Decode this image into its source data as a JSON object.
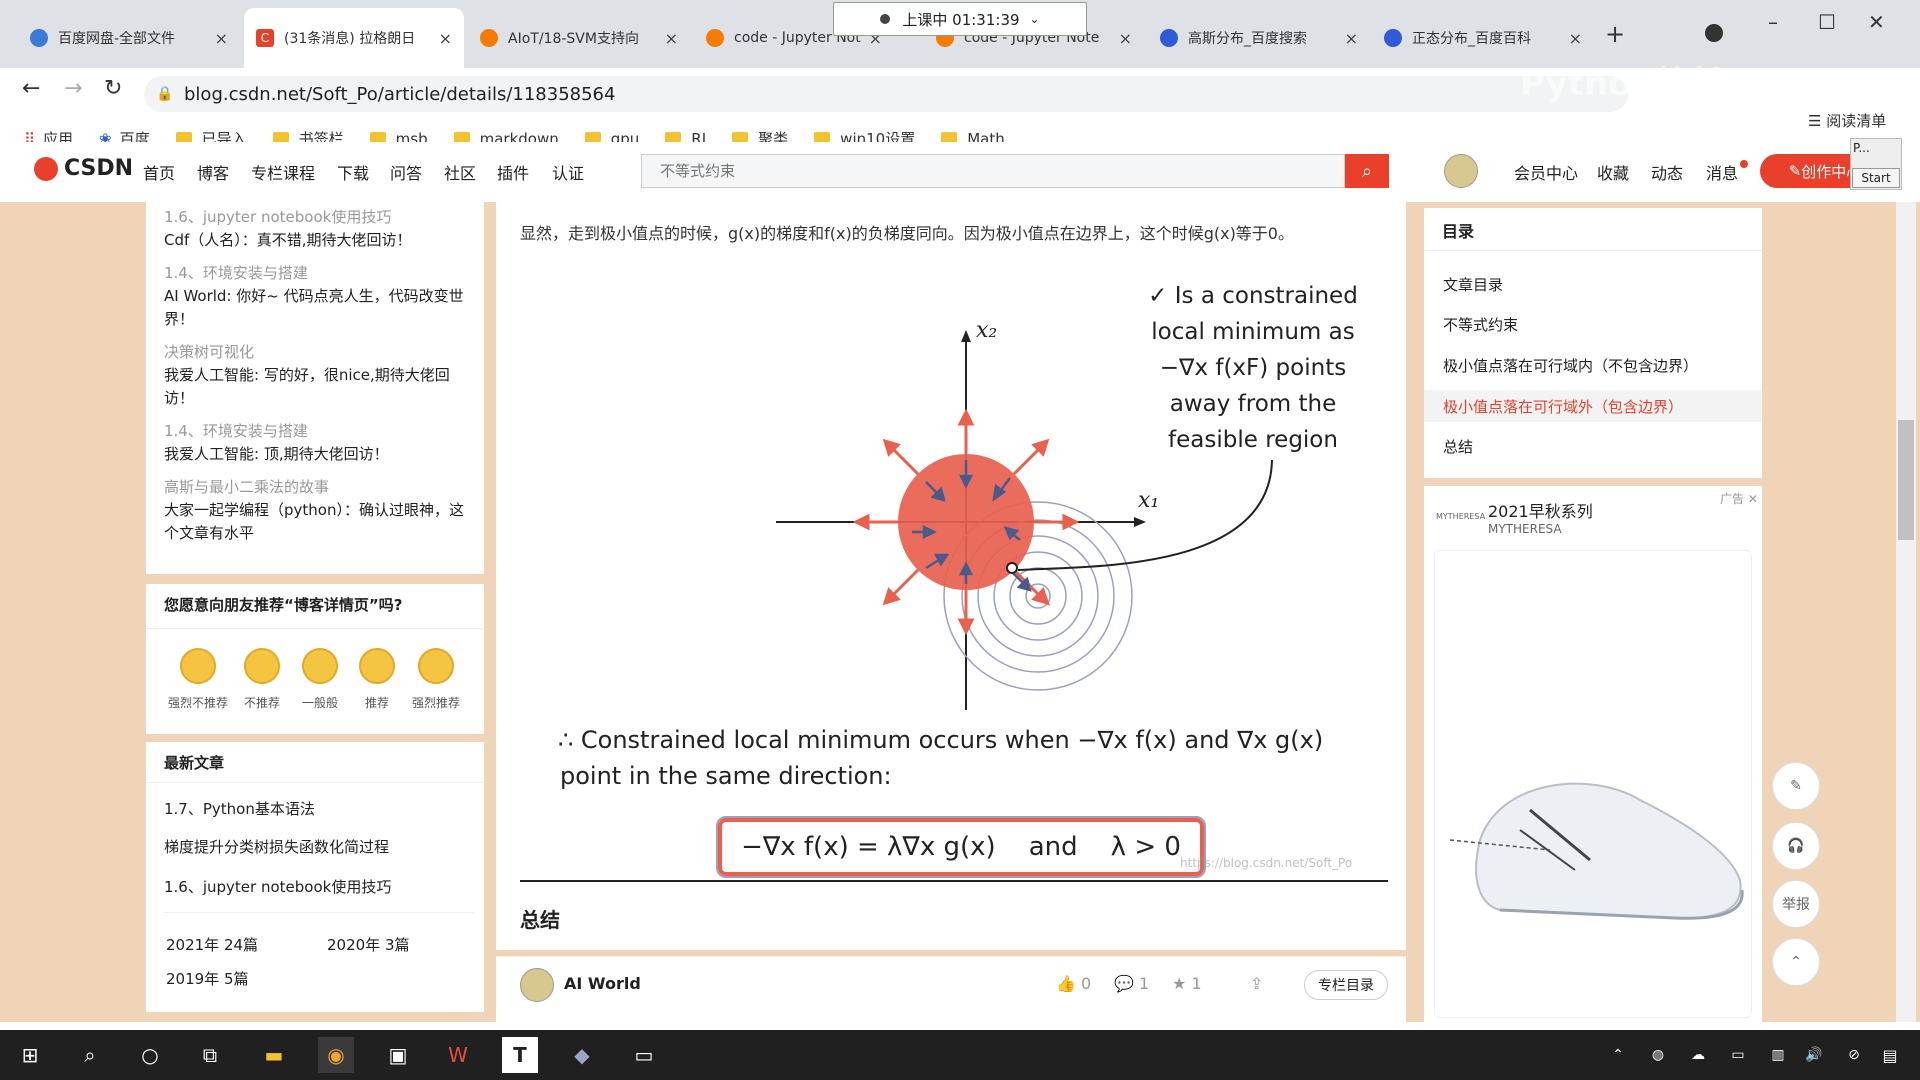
{
  "tabs": [
    {
      "title": "百度网盘-全部文件",
      "icon_color": "#3a7bd5"
    },
    {
      "title": "(31条消息) 拉格朗日",
      "icon_color": "#e8402b",
      "active": true
    },
    {
      "title": "AIoT/18-SVM支持向",
      "icon_color": "#f57c00"
    },
    {
      "title": "code - Jupyter Not",
      "icon_color": "#f57c00"
    },
    {
      "title": "code - Jupyter Note",
      "icon_color": "#f57c00"
    },
    {
      "title": "高斯分布_百度搜索",
      "icon_color": "#2f5bd8"
    },
    {
      "title": "正态分布_百度百科",
      "icon_color": "#2f5bd8"
    }
  ],
  "recording": "上课中 01:31:39",
  "url": "blog.csdn.net/Soft_Po/article/details/118358564",
  "watermark_top": "Python校长",
  "bookmarks": [
    "应用",
    "百度",
    "已导入",
    "书签栏",
    "msb",
    "markdown",
    "gpu",
    "RI",
    "聚类",
    "win10设置",
    "Math"
  ],
  "reading_list": "阅读清单",
  "csdn": {
    "logo": "CSDN",
    "nav": [
      "首页",
      "博客",
      "专栏课程",
      "下载",
      "问答",
      "社区",
      "插件",
      "认证"
    ],
    "search_placeholder": "不等式约束",
    "right": [
      "会员中心",
      "收藏",
      "动态",
      "消息"
    ],
    "create": "创作中心",
    "start_popup": "Start",
    "popup_p": "P..."
  },
  "sidebar_comments": [
    {
      "title": "1.6、jupyter notebook使用技巧",
      "comment": "Cdf（人名）：真不错,期待大佬回访！"
    },
    {
      "title": "1.4、环境安装与搭建",
      "comment": "AI World: 你好~ 代码点亮人生，代码改变世界！"
    },
    {
      "title": "决策树可视化",
      "comment": "我爱人工智能: 写的好，很nice,期待大佬回访！"
    },
    {
      "title": "1.4、环境安装与搭建",
      "comment": "我爱人工智能: 顶,期待大佬回访！"
    },
    {
      "title": "高斯与最小二乘法的故事",
      "comment": "大家一起学编程（python）：确认过眼神，这个文章有水平"
    }
  ],
  "recommend": {
    "question": "您愿意向朋友推荐“博客详情页”吗?",
    "options": [
      "强烈不推荐",
      "不推荐",
      "一般般",
      "推荐",
      "强烈推荐"
    ]
  },
  "latest": {
    "title": "最新文章",
    "items": [
      "1.7、Python基本语法",
      "梯度提升分类树损失函数化简过程",
      "1.6、jupyter notebook使用技巧"
    ],
    "archive": [
      "2021年 24篇",
      "2020年 3篇",
      "2019年 5篇"
    ]
  },
  "article": {
    "para": "显然，走到极小值点的时候，g(x)的梯度和f(x)的负梯度同向。因为极小值点在边界上，这个时候g(x)等于0。",
    "fig_note": [
      "✓ Is a constrained",
      "local minimum as",
      "−∇x f(xF) points",
      "away from the",
      "feasible region"
    ],
    "x1": "x₁",
    "x2": "x₂",
    "conclusion_line1": "∴ Constrained local minimum occurs when −∇x f(x) and ∇x g(x)",
    "conclusion_line2": "point in the same direction:",
    "box_formula": "−∇x f(x) = λ∇x g(x)    and    λ > 0",
    "watermark": "https://blog.csdn.net/Soft_Po",
    "section": "总结",
    "author": "AI World",
    "likes": "0",
    "comments": "1",
    "stars": "1",
    "column_btn": "专栏目录"
  },
  "toc": {
    "title": "目录",
    "items": [
      "文章目录",
      "不等式约束",
      "极小值点落在可行域内（不包含边界）",
      "极小值点落在可行域外（包含边界）",
      "总结"
    ],
    "active_index": 3,
    "active_color": "#e8402b"
  },
  "ad": {
    "label": "广告",
    "title": "2021早秋系列",
    "brand": "MYTHERESA",
    "small_brand": "MYTHERESA"
  },
  "float_buttons": [
    "edit-icon",
    "headset-icon",
    "举报",
    "top-icon"
  ],
  "colors": {
    "accent": "#e8402b",
    "circle": "#e8604e",
    "arrow_blue": "#4a5a8a"
  }
}
